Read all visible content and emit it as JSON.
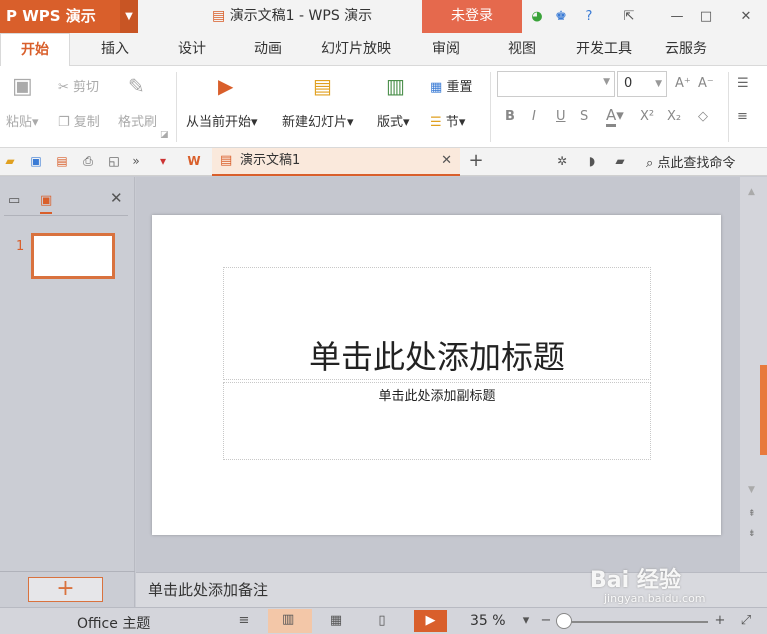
{
  "app": {
    "name": "WPS 演示",
    "doc_title": "演示文稿1 - WPS 演示",
    "login": "未登录"
  },
  "tabs": [
    "开始",
    "插入",
    "设计",
    "动画",
    "幻灯片放映",
    "审阅",
    "视图",
    "开发工具",
    "云服务"
  ],
  "ribbon": {
    "paste": "粘贴",
    "cut": "剪切",
    "copy": "复制",
    "format_painter": "格式刷",
    "from_current": "从当前开始",
    "new_slide": "新建幻灯片",
    "layout": "版式",
    "reset": "重置",
    "section": "节",
    "font_size": "0"
  },
  "doc_tab": "演示文稿1",
  "search": "点此查找命令",
  "thumb_number": "1",
  "slide": {
    "title": "单击此处添加标题",
    "subtitle": "单击此处添加副标题"
  },
  "notes": "单击此处添加备注",
  "status": {
    "theme": "Office 主题",
    "zoom": "35 %"
  },
  "watermark": {
    "brand": "Bai 经验",
    "url": "jingyan.baidu.com"
  },
  "colors": {
    "accent": "#d95f2b",
    "login": "#e5694d"
  }
}
